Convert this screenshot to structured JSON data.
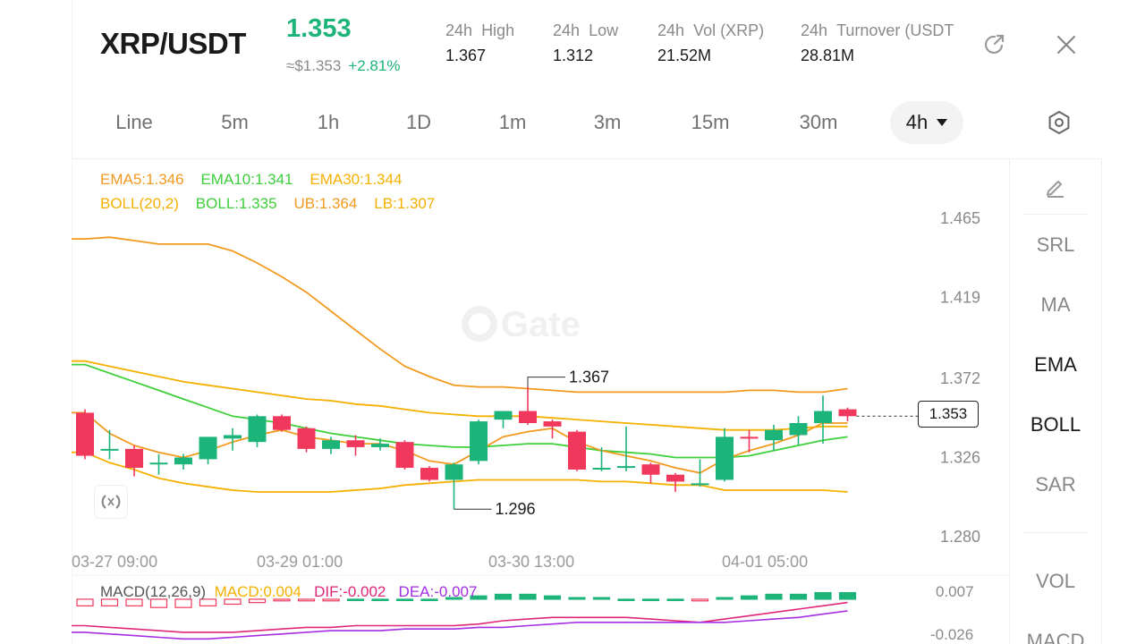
{
  "header": {
    "pair": "XRP/USDT",
    "price": "1.353",
    "fiat_price": "≈$1.353",
    "change": "+2.81%",
    "stats": [
      {
        "label1": "24h",
        "label2": "High",
        "value": "1.367"
      },
      {
        "label1": "24h",
        "label2": "Low",
        "value": "1.312"
      },
      {
        "label1": "24h",
        "label2": "Vol (XRP)",
        "value": "21.52M"
      },
      {
        "label1": "24h",
        "label2": "Turnover (USDT",
        "value": "28.81M"
      }
    ],
    "share_icon": "share-icon",
    "close_icon": "close-icon"
  },
  "timeframes": [
    "Line",
    "5m",
    "1h",
    "1D",
    "1m",
    "3m",
    "15m",
    "30m"
  ],
  "active_timeframe": "4h",
  "settings_icon": "hexagon-settings-icon",
  "indicators": {
    "ema5": "EMA5:1.346",
    "ema10": "EMA10:1.341",
    "ema30": "EMA30:1.344",
    "boll": "BOLL(20,2)",
    "boll_mid": "BOLL:1.335",
    "ub": "UB:1.364",
    "lb": "LB:1.307"
  },
  "watermark": "Gate",
  "sidebar": {
    "draw_icon": "pencil-icon",
    "items": [
      "SRL",
      "MA",
      "EMA",
      "BOLL",
      "SAR",
      "VOL",
      "MACD"
    ],
    "active": [
      "EMA",
      "BOLL"
    ]
  },
  "colors": {
    "up": "#1db47a",
    "down": "#f0385c",
    "ema5": "#f29a1f",
    "ema10": "#3ecf3a",
    "ema30": "#f5b000",
    "ub": "#f29a1f",
    "lb": "#f5b000",
    "mid": "#3ecf3a",
    "dif": "#e0267a",
    "dea": "#a52de3"
  },
  "macd": {
    "label": "MACD(12,26,9)",
    "macd": "MACD:0.004",
    "dif": "DIF:-0.002",
    "dea": "DEA:-0.007",
    "axis_top": "0.007",
    "axis_bottom": "-0.026"
  },
  "chart_data": {
    "type": "candlestick",
    "y_ticks": [
      "1.465",
      "1.419",
      "1.372",
      "1.326",
      "1.280"
    ],
    "ylim": [
      1.28,
      1.465
    ],
    "x_ticks": [
      "03-27 09:00",
      "03-29 01:00",
      "03-30 13:00",
      "04-01 05:00"
    ],
    "last_price": "1.353",
    "high_label": "1.367",
    "low_label": "1.296",
    "candles": [
      {
        "o": 1.352,
        "h": 1.354,
        "l": 1.325,
        "c": 1.327
      },
      {
        "o": 1.331,
        "h": 1.342,
        "l": 1.325,
        "c": 1.331
      },
      {
        "o": 1.331,
        "h": 1.333,
        "l": 1.315,
        "c": 1.32
      },
      {
        "o": 1.323,
        "h": 1.328,
        "l": 1.316,
        "c": 1.323
      },
      {
        "o": 1.322,
        "h": 1.328,
        "l": 1.319,
        "c": 1.326
      },
      {
        "o": 1.325,
        "h": 1.338,
        "l": 1.322,
        "c": 1.338
      },
      {
        "o": 1.337,
        "h": 1.343,
        "l": 1.33,
        "c": 1.339
      },
      {
        "o": 1.335,
        "h": 1.351,
        "l": 1.332,
        "c": 1.35
      },
      {
        "o": 1.35,
        "h": 1.351,
        "l": 1.341,
        "c": 1.342
      },
      {
        "o": 1.343,
        "h": 1.344,
        "l": 1.329,
        "c": 1.331
      },
      {
        "o": 1.331,
        "h": 1.338,
        "l": 1.328,
        "c": 1.336
      },
      {
        "o": 1.336,
        "h": 1.339,
        "l": 1.327,
        "c": 1.332
      },
      {
        "o": 1.332,
        "h": 1.337,
        "l": 1.33,
        "c": 1.334
      },
      {
        "o": 1.335,
        "h": 1.336,
        "l": 1.319,
        "c": 1.32
      },
      {
        "o": 1.32,
        "h": 1.321,
        "l": 1.312,
        "c": 1.313
      },
      {
        "o": 1.313,
        "h": 1.323,
        "l": 1.296,
        "c": 1.322
      },
      {
        "o": 1.324,
        "h": 1.348,
        "l": 1.322,
        "c": 1.347
      },
      {
        "o": 1.348,
        "h": 1.353,
        "l": 1.343,
        "c": 1.353
      },
      {
        "o": 1.353,
        "h": 1.367,
        "l": 1.345,
        "c": 1.346
      },
      {
        "o": 1.347,
        "h": 1.348,
        "l": 1.337,
        "c": 1.344
      },
      {
        "o": 1.341,
        "h": 1.342,
        "l": 1.318,
        "c": 1.319
      },
      {
        "o": 1.319,
        "h": 1.332,
        "l": 1.318,
        "c": 1.32
      },
      {
        "o": 1.321,
        "h": 1.344,
        "l": 1.318,
        "c": 1.321
      },
      {
        "o": 1.322,
        "h": 1.323,
        "l": 1.311,
        "c": 1.316
      },
      {
        "o": 1.316,
        "h": 1.317,
        "l": 1.306,
        "c": 1.312
      },
      {
        "o": 1.311,
        "h": 1.325,
        "l": 1.309,
        "c": 1.311
      },
      {
        "o": 1.313,
        "h": 1.343,
        "l": 1.312,
        "c": 1.338
      },
      {
        "o": 1.338,
        "h": 1.342,
        "l": 1.329,
        "c": 1.337
      },
      {
        "o": 1.336,
        "h": 1.345,
        "l": 1.33,
        "c": 1.342
      },
      {
        "o": 1.339,
        "h": 1.35,
        "l": 1.333,
        "c": 1.346
      },
      {
        "o": 1.346,
        "h": 1.362,
        "l": 1.334,
        "c": 1.353
      },
      {
        "o": 1.354,
        "h": 1.355,
        "l": 1.347,
        "c": 1.35
      }
    ],
    "ub": [
      1.453,
      1.454,
      1.452,
      1.45,
      1.45,
      1.45,
      1.446,
      1.439,
      1.431,
      1.422,
      1.411,
      1.4,
      1.389,
      1.379,
      1.373,
      1.368,
      1.367,
      1.367,
      1.366,
      1.365,
      1.364,
      1.364,
      1.364,
      1.364,
      1.364,
      1.364,
      1.364,
      1.365,
      1.365,
      1.364,
      1.364,
      1.366
    ],
    "lb": [
      1.329,
      1.323,
      1.319,
      1.314,
      1.311,
      1.309,
      1.307,
      1.306,
      1.306,
      1.306,
      1.306,
      1.307,
      1.308,
      1.31,
      1.311,
      1.312,
      1.313,
      1.313,
      1.313,
      1.313,
      1.313,
      1.312,
      1.312,
      1.311,
      1.31,
      1.31,
      1.307,
      1.307,
      1.307,
      1.307,
      1.307,
      1.306
    ],
    "ema30": [
      1.382,
      1.379,
      1.376,
      1.373,
      1.37,
      1.368,
      1.366,
      1.364,
      1.362,
      1.36,
      1.359,
      1.357,
      1.356,
      1.354,
      1.352,
      1.351,
      1.35,
      1.35,
      1.35,
      1.349,
      1.348,
      1.347,
      1.346,
      1.345,
      1.344,
      1.343,
      1.342,
      1.342,
      1.342,
      1.343,
      1.344,
      1.344
    ],
    "ema10": [
      1.38,
      1.375,
      1.37,
      1.365,
      1.36,
      1.355,
      1.35,
      1.348,
      1.346,
      1.343,
      1.34,
      1.338,
      1.336,
      1.334,
      1.333,
      1.332,
      1.332,
      1.333,
      1.334,
      1.334,
      1.332,
      1.33,
      1.329,
      1.328,
      1.326,
      1.326,
      1.326,
      1.327,
      1.33,
      1.333,
      1.336,
      1.338
    ],
    "ema5": [
      1.352,
      1.34,
      1.333,
      1.329,
      1.326,
      1.33,
      1.335,
      1.339,
      1.342,
      1.338,
      1.336,
      1.334,
      1.334,
      1.33,
      1.324,
      1.322,
      1.33,
      1.338,
      1.341,
      1.343,
      1.335,
      1.33,
      1.327,
      1.324,
      1.32,
      1.317,
      1.325,
      1.33,
      1.334,
      1.339,
      1.346,
      1.346
    ],
    "macd_hist": [
      -0.004,
      -0.004,
      -0.004,
      -0.005,
      -0.005,
      -0.004,
      -0.003,
      -0.002,
      -0.001,
      -0.001,
      -0.001,
      0.0,
      0.0,
      0.0,
      0.0,
      0.001,
      0.002,
      0.003,
      0.003,
      0.002,
      0.001,
      0.001,
      0.0,
      0.0,
      0.0,
      -0.001,
      0.001,
      0.002,
      0.003,
      0.003,
      0.004,
      0.004
    ],
    "dif": [
      -0.016,
      -0.017,
      -0.018,
      -0.019,
      -0.02,
      -0.02,
      -0.02,
      -0.019,
      -0.018,
      -0.017,
      -0.017,
      -0.016,
      -0.016,
      -0.016,
      -0.016,
      -0.016,
      -0.015,
      -0.013,
      -0.012,
      -0.011,
      -0.011,
      -0.011,
      -0.011,
      -0.012,
      -0.013,
      -0.014,
      -0.012,
      -0.01,
      -0.008,
      -0.006,
      -0.004,
      -0.002
    ],
    "dea": [
      -0.02,
      -0.021,
      -0.022,
      -0.023,
      -0.024,
      -0.024,
      -0.023,
      -0.022,
      -0.021,
      -0.02,
      -0.019,
      -0.019,
      -0.019,
      -0.018,
      -0.018,
      -0.018,
      -0.017,
      -0.017,
      -0.016,
      -0.015,
      -0.014,
      -0.014,
      -0.014,
      -0.014,
      -0.014,
      -0.014,
      -0.014,
      -0.013,
      -0.012,
      -0.011,
      -0.009,
      -0.007
    ],
    "macd_ylim": [
      -0.026,
      0.007
    ]
  }
}
